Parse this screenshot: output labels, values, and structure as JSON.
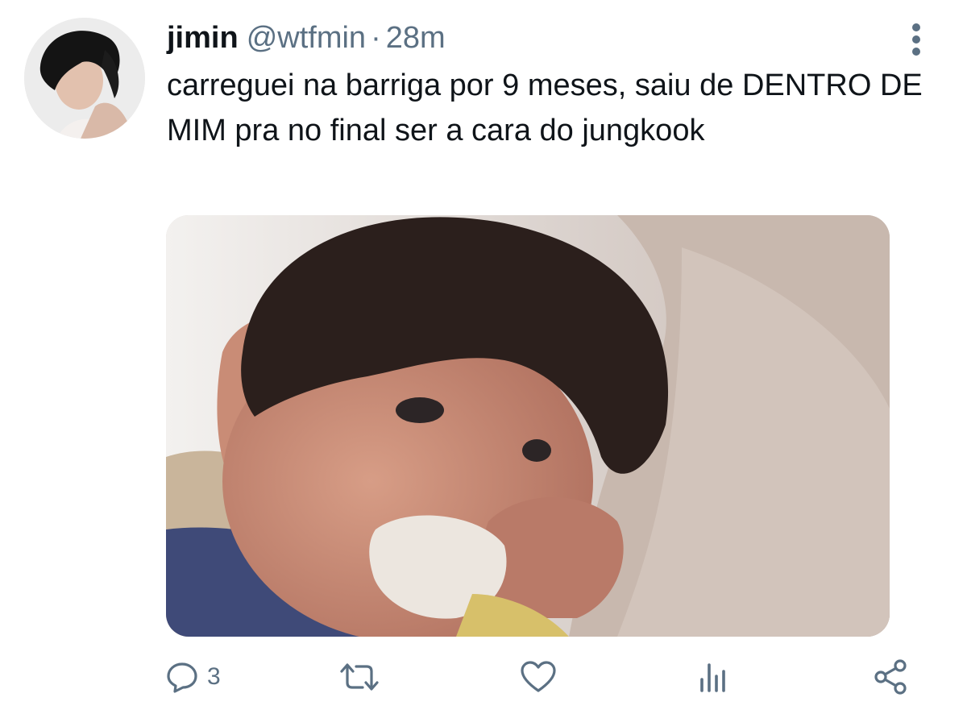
{
  "tweet": {
    "author": {
      "name": "jimin",
      "handle": "@wtfmin",
      "separator": "·",
      "time": "28m"
    },
    "text": "carreguei na barriga por 9 meses, saiu de DENTRO DE MIM pra no final ser a cara do jungkook",
    "actions": {
      "reply_count": "3"
    },
    "icons": {
      "more": "more-vertical-icon",
      "reply": "reply-icon",
      "retweet": "retweet-icon",
      "like": "heart-icon",
      "analytics": "analytics-icon",
      "share": "share-icon"
    },
    "colors": {
      "text": "#0f1419",
      "secondary": "#5b7083",
      "background": "#ffffff"
    }
  }
}
